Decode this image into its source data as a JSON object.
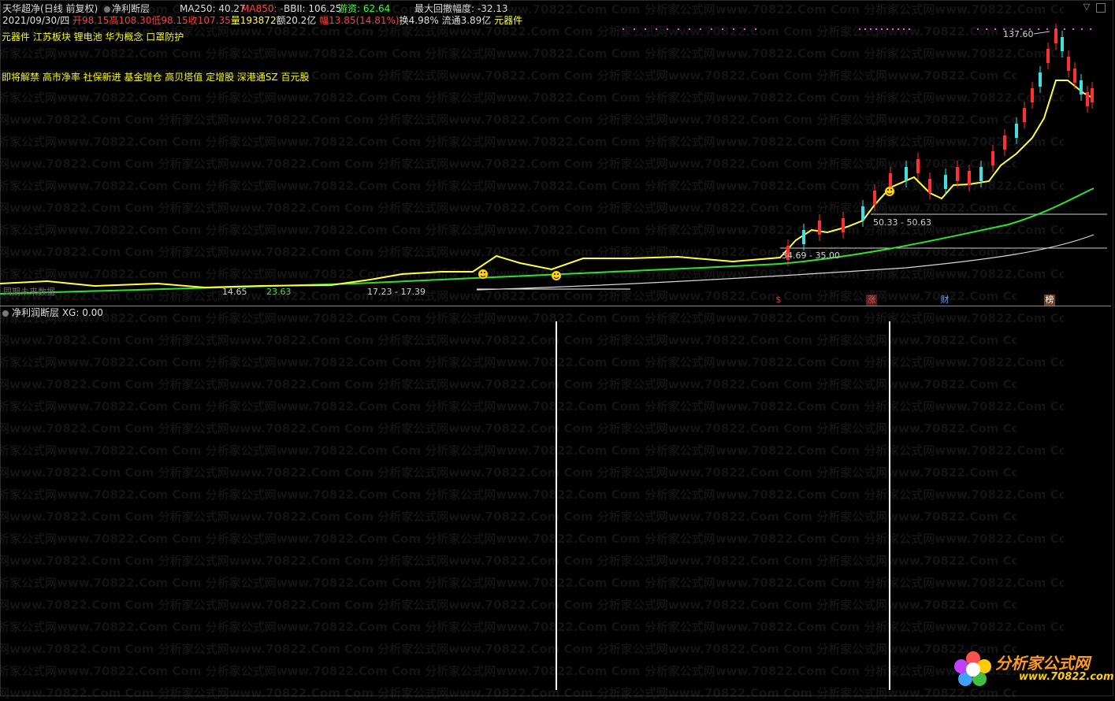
{
  "header": {
    "app_title": "天华超净",
    "period": "(日线 前复权)",
    "indicator_name": "净利断层",
    "ma250_label": "MA250: 40.27",
    "ma850_label": "MA850: -",
    "bbii_label": "BBII: 106.25",
    "youzi_label": "游资: 62.64",
    "max_drawdown_label": "最大回撤幅度: -32.13"
  },
  "quote_line": {
    "date": "2021/09/30/四",
    "open": "开98.15",
    "high": "高108.30",
    "low": "低98.15",
    "close": "收107.35",
    "volume": "量193872",
    "amount": "额20.2亿",
    "change": "幅13.85(14.81%)",
    "turnover": "换4.98%",
    "float_cap": "流通3.89亿",
    "sector": "元器件"
  },
  "tags_line1": "元器件 江苏板块 锂电池 华为概念 口罩防护",
  "tags_line2": "即将解禁 高市净率 社保新进 基金增仓 高贝塔值 定增股 深港通SZ 百元股",
  "price_labels": {
    "peak": "137.60",
    "range1": "50.33 - 50.63",
    "range2": "34.69 - 35.00",
    "range3": "17.23 - 17.39",
    "low1": "14.65",
    "low2": "23.63"
  },
  "note": "同期未来数据",
  "badges": [
    "$",
    "涨",
    "财",
    "榜"
  ],
  "lower_panel_title": "净利润断层  XG: 0.00",
  "watermark": "分析家公式网www.70822.Com",
  "logo": {
    "text": "分析家公式网",
    "url": "www.70822.com"
  },
  "colors": {
    "price_line": "#ffff40",
    "ma_green": "#30e030",
    "ma_white": "#d8d8d8",
    "up_candle": "#ff3030",
    "down_candle": "#40e0e0",
    "magenta": "#ff40ff"
  }
}
